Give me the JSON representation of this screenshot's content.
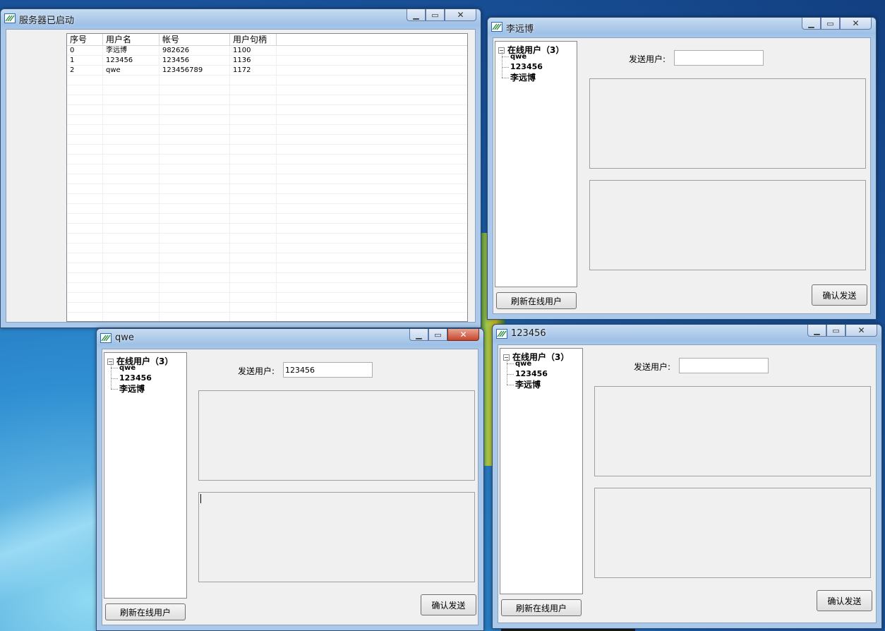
{
  "server_window": {
    "title": "服务器已启动",
    "columns": [
      "序号",
      "用户名",
      "帐号",
      "用户句柄"
    ],
    "rows": [
      [
        "0",
        "李远博",
        "982626",
        "1100"
      ],
      [
        "1",
        "123456",
        "123456",
        "1136"
      ],
      [
        "2",
        "qwe",
        "123456789",
        "1172"
      ]
    ]
  },
  "client_windows": [
    {
      "title": "李远博",
      "tree_root": "在线用户（3）",
      "tree_children": [
        "qwe",
        "123456",
        "李远博"
      ],
      "send_user_label": "发送用户:",
      "send_user_value": "",
      "refresh_button": "刷新在线用户",
      "confirm_button": "确认发送"
    },
    {
      "title": "qwe",
      "tree_root": "在线用户（3）",
      "tree_children": [
        "qwe",
        "123456",
        "李远博"
      ],
      "send_user_label": "发送用户:",
      "send_user_value": "123456",
      "refresh_button": "刷新在线用户",
      "confirm_button": "确认发送"
    },
    {
      "title": "123456",
      "tree_root": "在线用户（3）",
      "tree_children": [
        "qwe",
        "123456",
        "李远博"
      ],
      "send_user_label": "发送用户:",
      "send_user_value": "",
      "refresh_button": "刷新在线用户",
      "confirm_button": "确认发送"
    }
  ],
  "colors": {
    "title_gradient_top": "#c6dcf1",
    "client_bg": "#f0f0f0",
    "close_active": "#c7452b"
  }
}
